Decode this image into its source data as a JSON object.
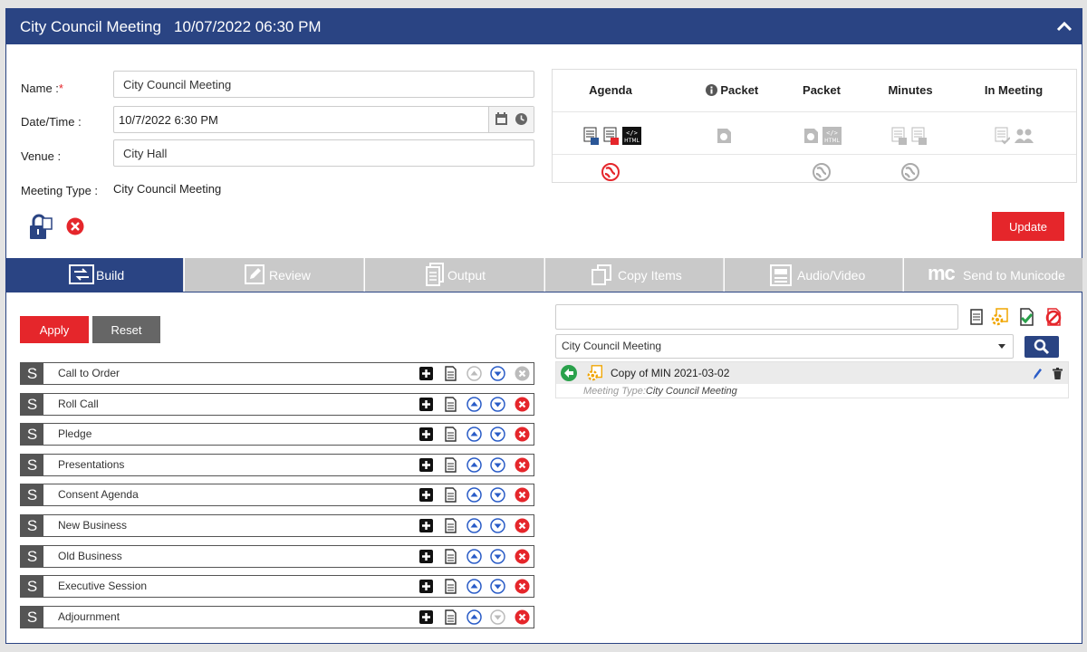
{
  "header": {
    "title": "City Council Meeting",
    "datetime": "10/07/2022 06:30 PM"
  },
  "form": {
    "name_label": "Name :",
    "required_mark": "*",
    "name_value": "City Council Meeting",
    "datetime_label": "Date/Time :",
    "datetime_value": "10/7/2022 6:30 PM",
    "venue_label": "Venue :",
    "venue_value": "City Hall",
    "meeting_type_label": "Meeting Type :",
    "meeting_type_value": "City Council Meeting"
  },
  "documents": {
    "columns": [
      "Agenda",
      "Packet",
      "Packet",
      "Minutes",
      "In Meeting"
    ]
  },
  "update_label": "Update",
  "tabs": [
    {
      "label": "Build"
    },
    {
      "label": "Review"
    },
    {
      "label": "Output"
    },
    {
      "label": "Copy Items"
    },
    {
      "label": "Audio/Video"
    },
    {
      "label": "Send to Municode"
    }
  ],
  "tabs_mc_logo": "mc",
  "build": {
    "apply_label": "Apply",
    "reset_label": "Reset",
    "section_badge": "S",
    "sections": [
      {
        "name": "Call to Order",
        "up_disabled": true,
        "down_disabled": false,
        "delete_disabled": true
      },
      {
        "name": "Roll Call",
        "up_disabled": false,
        "down_disabled": false,
        "delete_disabled": false
      },
      {
        "name": "Pledge",
        "up_disabled": false,
        "down_disabled": false,
        "delete_disabled": false
      },
      {
        "name": "Presentations",
        "up_disabled": false,
        "down_disabled": false,
        "delete_disabled": false
      },
      {
        "name": "Consent Agenda",
        "up_disabled": false,
        "down_disabled": false,
        "delete_disabled": false
      },
      {
        "name": "New Business",
        "up_disabled": false,
        "down_disabled": false,
        "delete_disabled": false
      },
      {
        "name": "Old Business",
        "up_disabled": false,
        "down_disabled": false,
        "delete_disabled": false
      },
      {
        "name": "Executive Session",
        "up_disabled": false,
        "down_disabled": false,
        "delete_disabled": false
      },
      {
        "name": "Adjournment",
        "up_disabled": false,
        "down_disabled": true,
        "delete_disabled": false
      }
    ]
  },
  "templates": {
    "search_value": "",
    "filter_selected": "City Council Meeting",
    "results": [
      {
        "name": "Copy of MIN 2021-03-02",
        "meta_label": "Meeting Type:",
        "meta_value": "City Council Meeting"
      }
    ]
  },
  "colors": {
    "brand": "#2a4483",
    "danger": "#e5262b",
    "neutral": "#666666"
  }
}
